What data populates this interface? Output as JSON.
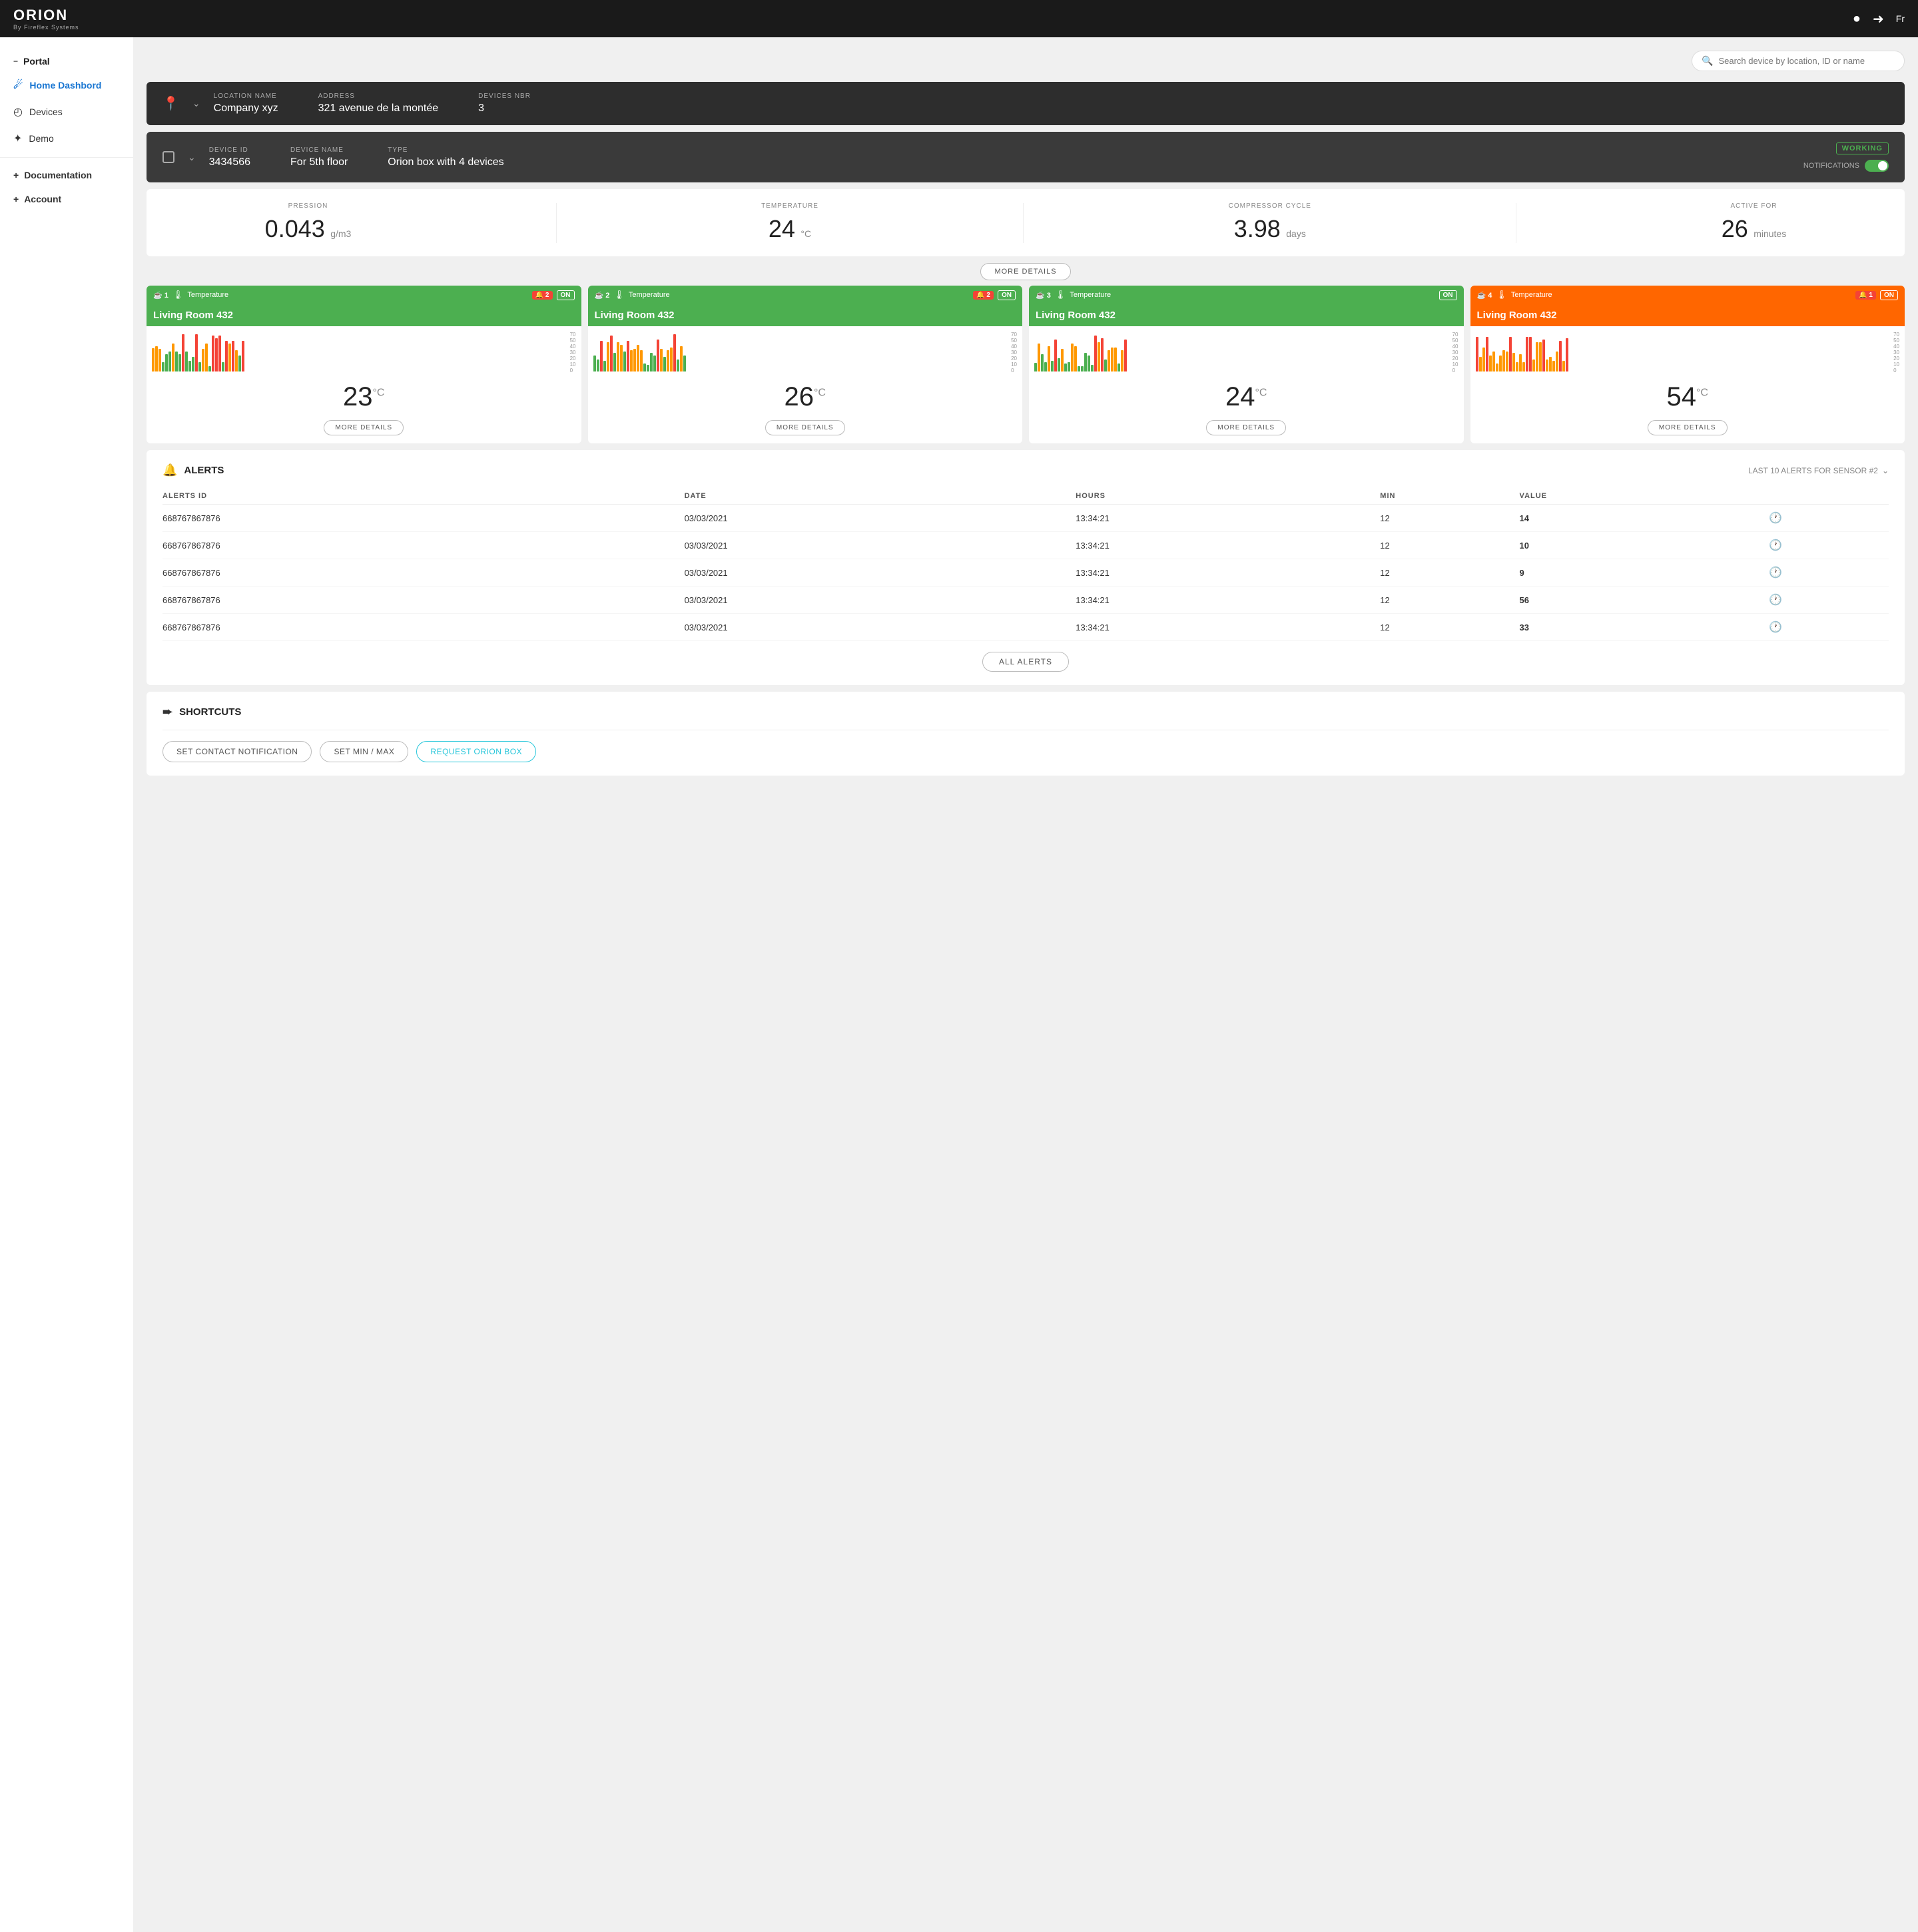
{
  "topnav": {
    "logo_main": "ORION",
    "logo_sub": "By Fireflex Systems",
    "lang": "Fr"
  },
  "search": {
    "placeholder": "Search device by location, ID or name"
  },
  "sidebar": {
    "portal_label": "Portal",
    "items": [
      {
        "id": "home-dashboard",
        "label": "Home Dashbord",
        "active": true
      },
      {
        "id": "devices",
        "label": "Devices",
        "active": false
      },
      {
        "id": "demo",
        "label": "Demo",
        "active": false
      }
    ],
    "add_items": [
      {
        "id": "documentation",
        "label": "Documentation"
      },
      {
        "id": "account",
        "label": "Account"
      }
    ]
  },
  "location": {
    "name_label": "LOCATION NAME",
    "name_value": "Company xyz",
    "address_label": "ADDRESS",
    "address_value": "321 avenue de la montée",
    "devices_nbr_label": "DEVICES NBR",
    "devices_nbr_value": "3"
  },
  "device": {
    "id_label": "DEVICE ID",
    "id_value": "3434566",
    "name_label": "DEVICE NAME",
    "name_value": "For 5th floor",
    "type_label": "TYPE",
    "type_value": "Orion box with 4 devices",
    "status": "WORKING",
    "notifications_label": "NOTIFICATIONS"
  },
  "stats": {
    "pression_label": "PRESSION",
    "pression_value": "0.043",
    "pression_unit": "g/m3",
    "temperature_label": "TEMPERATURE",
    "temperature_value": "24",
    "temperature_unit": "°C",
    "compressor_label": "COMPRESSOR CYCLE",
    "compressor_value": "3.98",
    "compressor_unit": "days",
    "active_label": "ACTIVE FOR",
    "active_value": "26",
    "active_unit": "minutes",
    "more_details": "MORE DETAILS"
  },
  "sensors": [
    {
      "num": "1",
      "type": "Temperature",
      "alerts": "2",
      "status": "ON",
      "name": "Living Room 432",
      "temp": "23",
      "unit": "°C",
      "color": "green",
      "more_details": "MORE DETAILS"
    },
    {
      "num": "2",
      "type": "Temperature",
      "alerts": "2",
      "status": "ON",
      "name": "Living Room 432",
      "temp": "26",
      "unit": "°C",
      "color": "green",
      "more_details": "MORE DETAILS"
    },
    {
      "num": "3",
      "type": "Temperature",
      "alerts": null,
      "status": "ON",
      "name": "Living Room 432",
      "temp": "24",
      "unit": "°C",
      "color": "green",
      "more_details": "MORE DETAILS"
    },
    {
      "num": "4",
      "type": "Temperature",
      "alerts": "1",
      "status": "ON",
      "name": "Living Room 432",
      "temp": "54",
      "unit": "°C",
      "color": "orange",
      "more_details": "MORE DETAILS"
    }
  ],
  "alerts": {
    "title": "ALERTS",
    "sensor_label": "LAST 10 ALERTS FOR SENSOR #2",
    "columns": {
      "id": "ALERTS ID",
      "date": "DATE",
      "hours": "HOURS",
      "min": "MIN",
      "value": "VALUE"
    },
    "rows": [
      {
        "id": "668767867876",
        "date": "03/03/2021",
        "hours": "13:34:21",
        "min": "12",
        "value": "14"
      },
      {
        "id": "668767867876",
        "date": "03/03/2021",
        "hours": "13:34:21",
        "min": "12",
        "value": "10"
      },
      {
        "id": "668767867876",
        "date": "03/03/2021",
        "hours": "13:34:21",
        "min": "12",
        "value": "9"
      },
      {
        "id": "668767867876",
        "date": "03/03/2021",
        "hours": "13:34:21",
        "min": "12",
        "value": "56"
      },
      {
        "id": "668767867876",
        "date": "03/03/2021",
        "hours": "13:34:21",
        "min": "12",
        "value": "33"
      }
    ],
    "all_alerts": "ALL ALERTS"
  },
  "shortcuts": {
    "title": "SHORTCUTS",
    "buttons": [
      {
        "id": "set-contact",
        "label": "SET CONTACT NOTIFICATION",
        "type": "default"
      },
      {
        "id": "set-min-max",
        "label": "SET MIN / MAX",
        "type": "default"
      },
      {
        "id": "request-orion",
        "label": "REQUEST ORION BOX",
        "type": "primary"
      }
    ]
  },
  "colors": {
    "green": "#4caf50",
    "orange": "#ff6600",
    "orange_alert": "#ff9800",
    "working": "#4caf50",
    "cyan": "#26c6da"
  }
}
